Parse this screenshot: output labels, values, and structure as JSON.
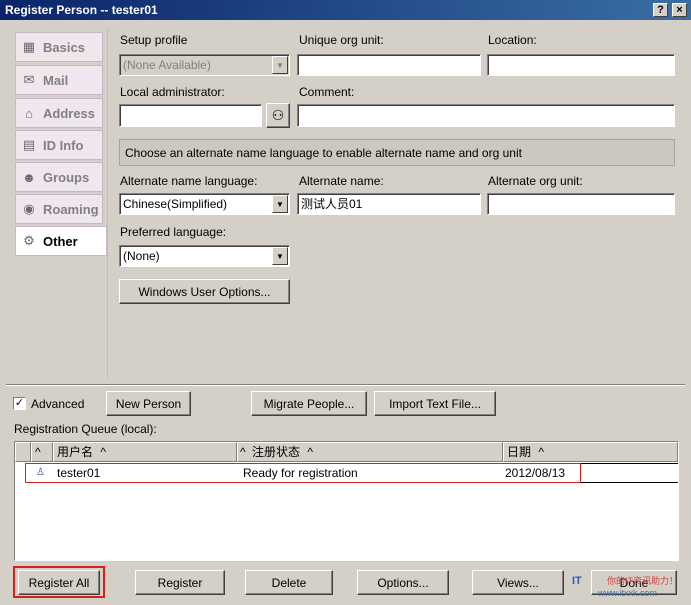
{
  "window": {
    "title": "Register Person -- tester01",
    "help_btn": "?",
    "close_btn": "×"
  },
  "nav": {
    "items": [
      {
        "label": "Basics",
        "icon": "basics-icon",
        "glyph": "▦"
      },
      {
        "label": "Mail",
        "icon": "mail-icon",
        "glyph": "✉"
      },
      {
        "label": "Address",
        "icon": "house-icon",
        "glyph": "⌂"
      },
      {
        "label": "ID Info",
        "icon": "id-card-icon",
        "glyph": "▤"
      },
      {
        "label": "Groups",
        "icon": "groups-icon",
        "glyph": "☻"
      },
      {
        "label": "Roaming",
        "icon": "globe-icon",
        "glyph": "◉"
      },
      {
        "label": "Other",
        "icon": "gear-icon",
        "glyph": "⚙"
      }
    ],
    "active": "Other"
  },
  "form": {
    "setup_profile": {
      "label": "Setup profile",
      "value": "(None Available)"
    },
    "unique_org_unit": {
      "label": "Unique org unit:",
      "value": ""
    },
    "location": {
      "label": "Location:",
      "value": ""
    },
    "local_admin": {
      "label": "Local administrator:",
      "value": ""
    },
    "comment": {
      "label": "Comment:",
      "value": ""
    },
    "notice": "Choose an alternate name language to enable alternate name and org unit",
    "alt_lang": {
      "label": "Alternate name language:",
      "value": "Chinese(Simplified)"
    },
    "alt_name": {
      "label": "Alternate name:",
      "value": "测试人员01"
    },
    "alt_org_unit": {
      "label": "Alternate org unit:",
      "value": ""
    },
    "pref_lang": {
      "label": "Preferred language:",
      "value": "(None)"
    },
    "windows_user_options": "Windows User Options..."
  },
  "bottom": {
    "advanced_label": "Advanced",
    "advanced_checked": "✓",
    "new_person": "New Person",
    "migrate": "Migrate People...",
    "import": "Import Text File...",
    "queue_label": "Registration Queue (local):",
    "columns": [
      "用户名",
      "注册状态",
      "日期"
    ],
    "sort_glyph": "^",
    "rows": [
      {
        "user": "tester01",
        "status": "Ready for registration",
        "date": "2012/08/13"
      }
    ],
    "buttons": {
      "register_all": "Register All",
      "register": "Register",
      "delete": "Delete",
      "options": "Options...",
      "views": "Views...",
      "done": "Done"
    },
    "watermark_top": "你的IT资讯助力！",
    "watermark_url": "www.itxxk.com"
  }
}
